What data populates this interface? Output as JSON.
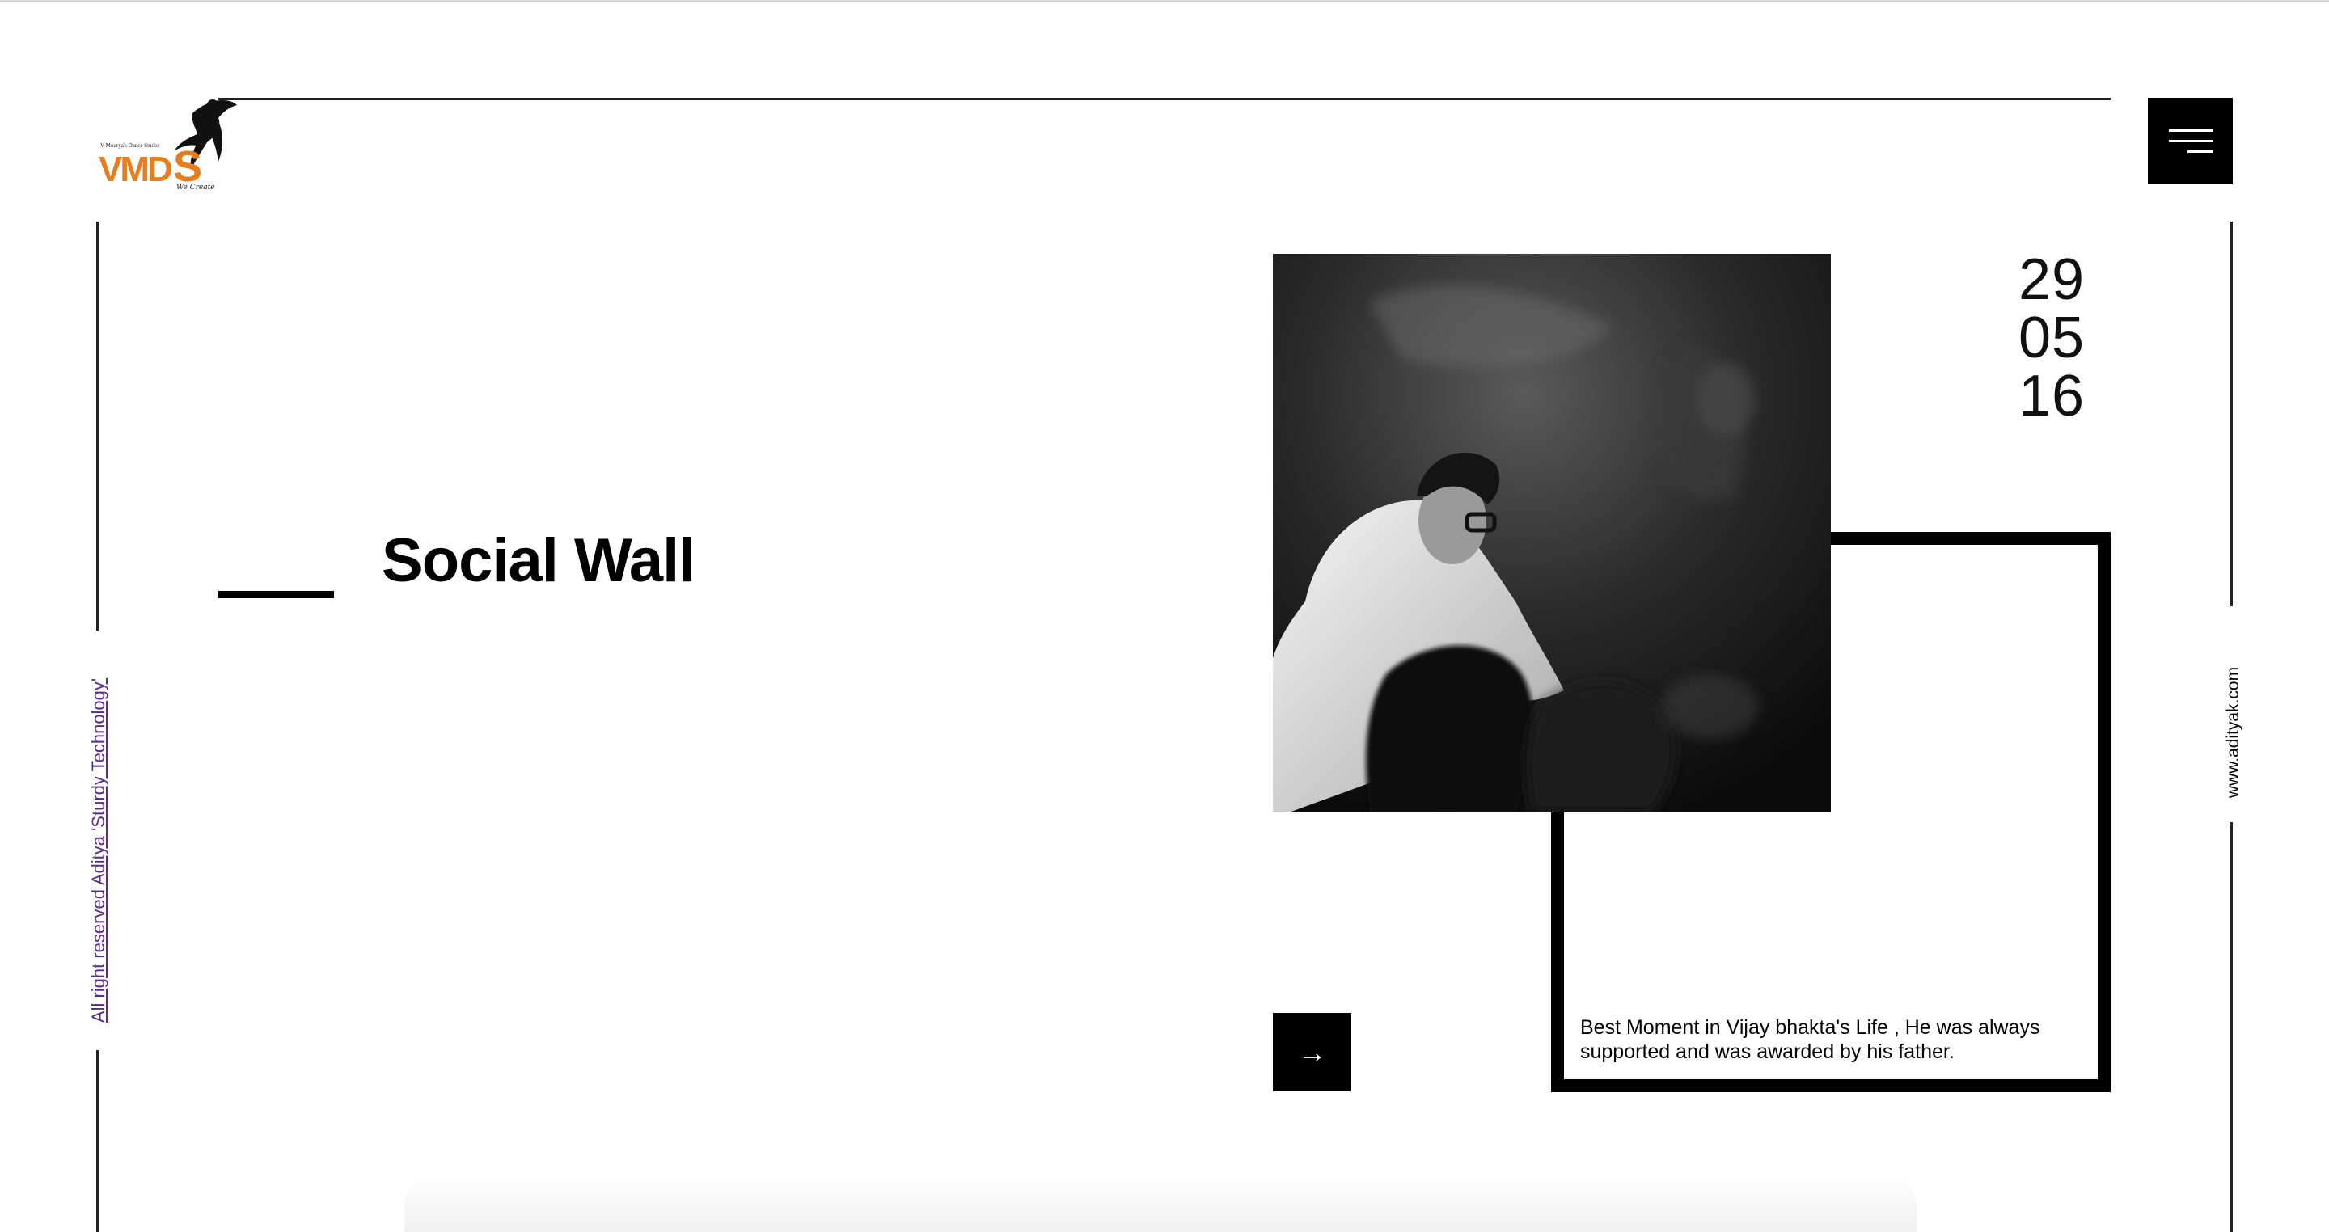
{
  "header": {
    "logo": {
      "wordmark": "VMDS",
      "tagline": "V Mourya's Dance Studio",
      "signature": "We Create",
      "colors": {
        "orange": "#e87d1e",
        "dark": "#111111"
      }
    },
    "menu_icon": "hamburger-menu-icon"
  },
  "main": {
    "title": "Social Wall"
  },
  "post": {
    "date": {
      "day": "29",
      "month": "05",
      "year": "16"
    },
    "caption": "Best Moment in Vijay bhakta's Life , He was always supported and was awarded by his father.",
    "photo": "black-and-white photo of a man in a white shirt with glasses",
    "next_icon": "arrow-right-icon",
    "next_symbol": "→"
  },
  "footer": {
    "rights": "All right reserved Aditya 'Sturdy Technology'",
    "site": "www.adityak.com"
  },
  "colors": {
    "background": "#ffffff",
    "accent": "#000000",
    "link": "#5b2b86",
    "logo_orange": "#e87d1e"
  }
}
